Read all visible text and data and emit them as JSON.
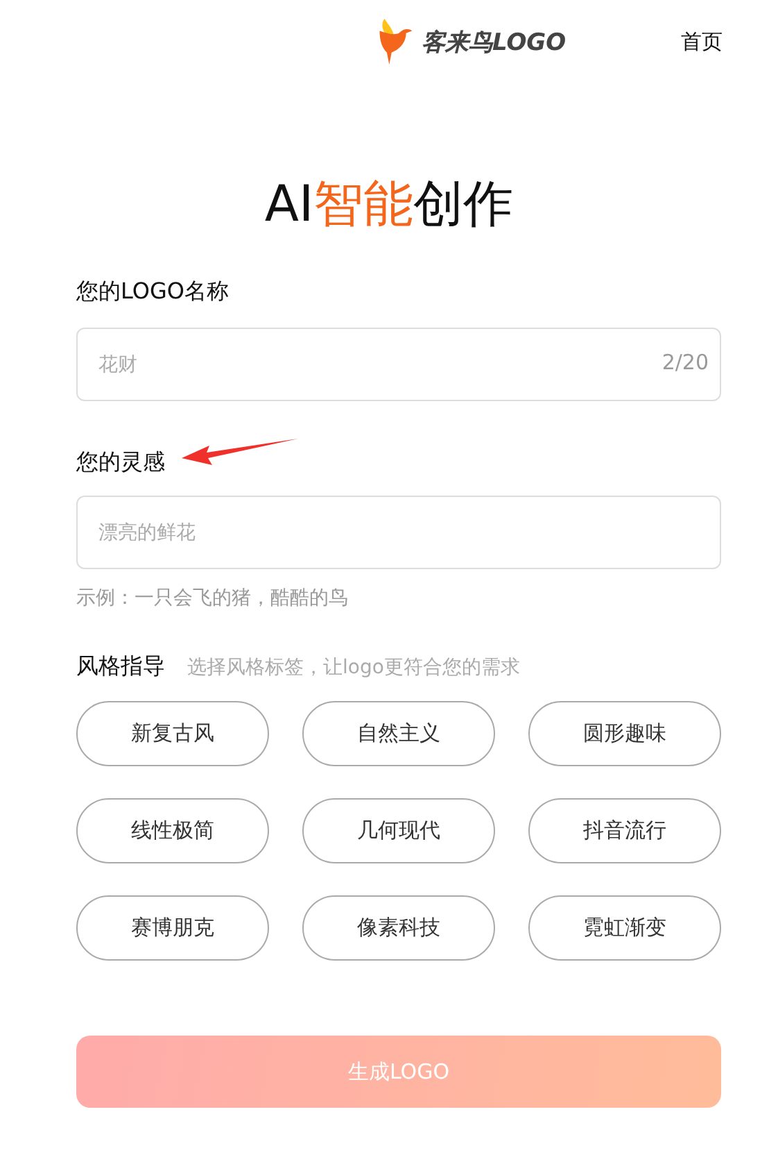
{
  "header": {
    "brand": "客来鸟LOGO",
    "nav": [
      {
        "label": "首页"
      }
    ]
  },
  "title_parts": [
    {
      "text": "AI",
      "highlight": false
    },
    {
      "text": "智能",
      "highlight": true
    },
    {
      "text": "创作",
      "highlight": false
    }
  ],
  "name_field": {
    "label": "您的LOGO名称",
    "placeholder": "花财",
    "counter": "2/20"
  },
  "inspiration_field": {
    "label": "您的灵感",
    "placeholder": "漂亮的鲜花",
    "example": "示例：一只会飞的猪，酷酷的鸟"
  },
  "style_guide": {
    "label": "风格指导",
    "hint": "选择风格标签，让logo更符合您的需求",
    "tags": [
      {
        "label": "新复古风",
        "selected": false
      },
      {
        "label": "自然主义",
        "selected": false
      },
      {
        "label": "圆形趣味",
        "selected": false
      },
      {
        "label": "线性极简",
        "selected": false
      },
      {
        "label": "几何现代",
        "selected": false
      },
      {
        "label": "抖音流行",
        "selected": false
      },
      {
        "label": "赛博朋克",
        "selected": false
      },
      {
        "label": "像素科技",
        "selected": false
      },
      {
        "label": "霓虹渐变",
        "selected": false
      }
    ]
  },
  "submit": {
    "label": "生成LOGO",
    "disabled": true
  }
}
